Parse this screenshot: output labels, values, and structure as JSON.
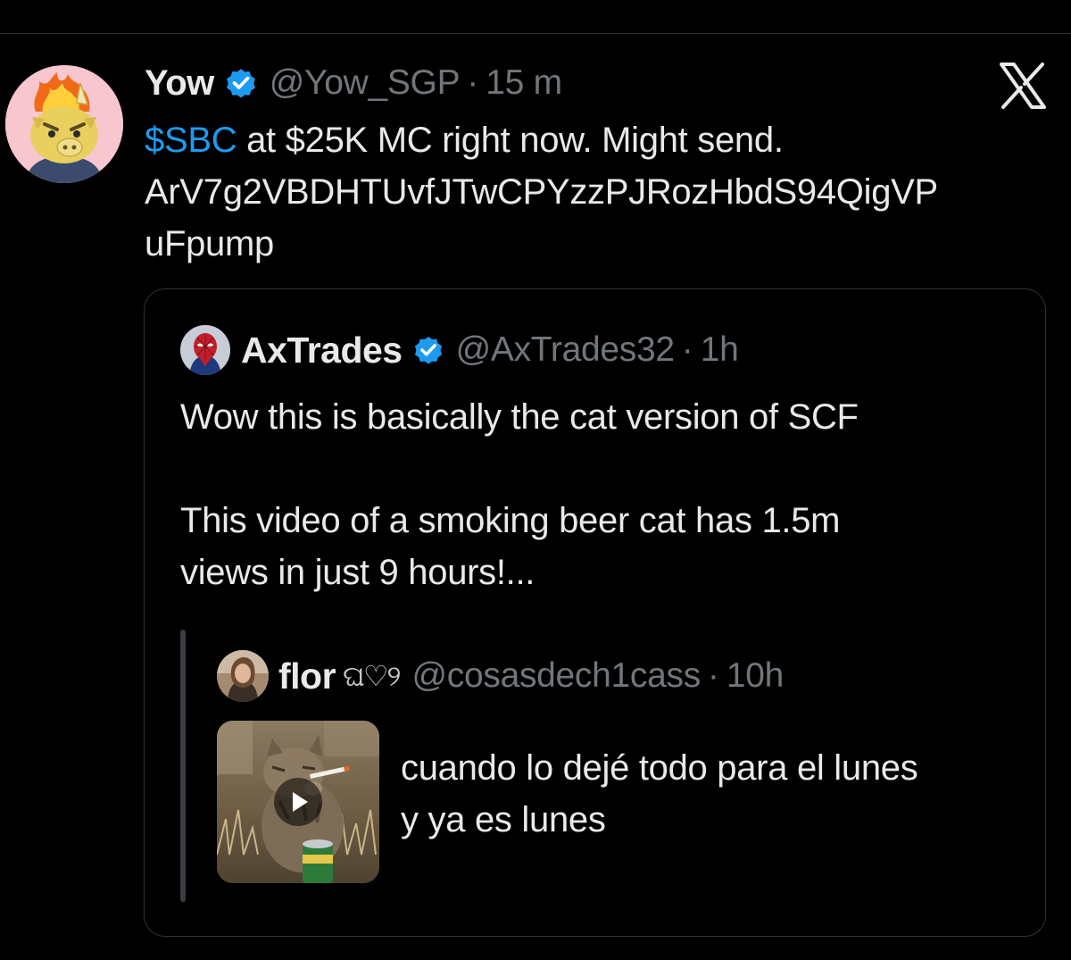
{
  "tweet": {
    "author_name": "Yow",
    "handle": "@Yow_SGP",
    "separator": "·",
    "time": "15 m",
    "cashtag": "$SBC",
    "line1_rest": " at $25K MC right now. Might send.",
    "line2": "ArV7g2VBDHTUvfJTwCPYzzPJRozHbdS94QigVP",
    "line3": "uFpump"
  },
  "quote": {
    "author_name": "AxTrades",
    "handle": "@AxTrades32",
    "separator": "·",
    "time": "1h",
    "lines": [
      "Wow this is basically the cat version of SCF",
      "",
      "This video of a smoking beer cat has 1.5m",
      "views in just 9 hours!..."
    ]
  },
  "nested_quote": {
    "author_name": "flor",
    "name_emoji": "ଘ♡୨",
    "handle": "@cosasdech1cass",
    "separator": "·",
    "time": "10h",
    "lines": [
      "cuando lo dejé todo para el lunes",
      "y ya es lunes"
    ]
  },
  "icons": {
    "verified": "verified-badge-icon",
    "close": "x-logo-icon",
    "play": "play-icon"
  },
  "colors": {
    "background": "#000000",
    "text": "#e7e9ea",
    "muted": "#71767b",
    "accent": "#1d9bf0",
    "border": "#2f3336"
  }
}
